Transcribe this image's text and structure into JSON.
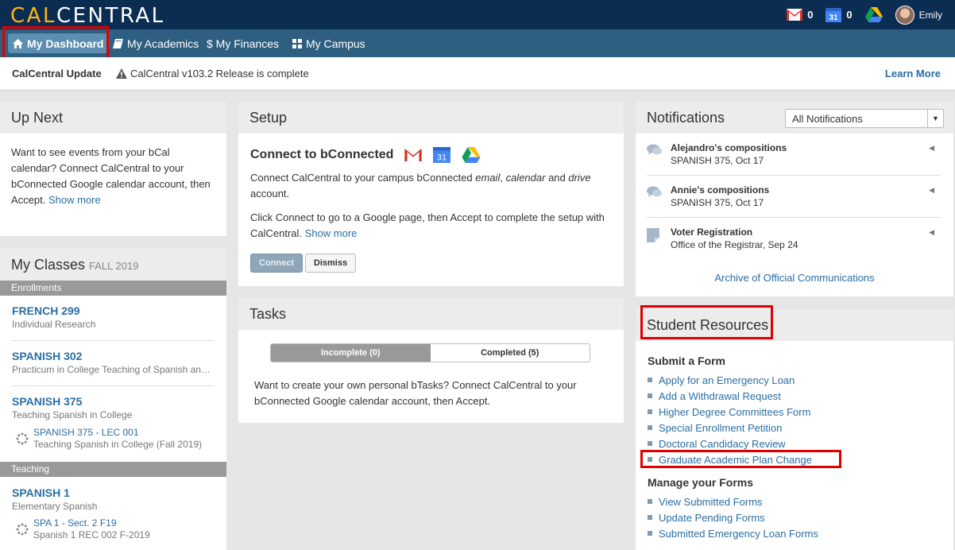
{
  "header": {
    "logo_a": "CAL",
    "logo_b": "CENTRAL",
    "mail_count": "0",
    "calendar_day": "31",
    "calendar_count": "0",
    "user_name": "Emily"
  },
  "nav": [
    {
      "label": "My Dashboard",
      "icon": "home-icon"
    },
    {
      "label": "My Academics",
      "icon": "book-icon"
    },
    {
      "label": "$ My Finances",
      "icon": "dollar-icon"
    },
    {
      "label": "My Campus",
      "icon": "grid-icon"
    }
  ],
  "update": {
    "label": "CalCentral Update",
    "message": "CalCentral v103.2 Release is complete",
    "learn_more": "Learn More"
  },
  "upnext": {
    "title": "Up Next",
    "text": "Want to see events from your bCal calendar? Connect CalCentral to your bConnected Google calendar account, then Accept.",
    "show_more": "Show more"
  },
  "classes": {
    "title": "My Classes",
    "term": "FALL 2019",
    "enrollments_label": "Enrollments",
    "teaching_label": "Teaching",
    "enrollments": [
      {
        "title": "FRENCH 299",
        "desc": "Individual Research"
      },
      {
        "title": "SPANISH 302",
        "desc": "Practicum in College Teaching of Spanish and Portuguese"
      },
      {
        "title": "SPANISH 375",
        "desc": "Teaching Spanish in College",
        "sub_title": "SPANISH 375 - LEC 001",
        "sub_desc": "Teaching Spanish in College (Fall 2019)"
      }
    ],
    "teaching": [
      {
        "title": "SPANISH 1",
        "desc": "Elementary Spanish",
        "sub_title": "SPA 1 - Sect. 2 F19",
        "sub_desc": "Spanish 1 REC 002 F-2019"
      }
    ]
  },
  "setup": {
    "title": "Setup",
    "connect_title": "Connect to bConnected",
    "p1a": "Connect CalCentral to your campus bConnected ",
    "p1_email": "email",
    "p1_sep1": ", ",
    "p1_calendar": "calendar",
    "p1_and": " and ",
    "p1_drive": "drive",
    "p1b": " account.",
    "p2": "Click Connect to go to a Google page, then Accept to complete the setup with CalCentral.",
    "show_more": "Show more",
    "connect_btn": "Connect",
    "dismiss_btn": "Dismiss"
  },
  "tasks": {
    "title": "Tasks",
    "tab_incomplete": "Incomplete (0)",
    "tab_completed": "Completed (5)",
    "text": "Want to create your own personal bTasks? Connect CalCentral to your bConnected Google calendar account, then Accept."
  },
  "notifications": {
    "title": "Notifications",
    "filter": "All Notifications",
    "items": [
      {
        "title": "Alejandro's compositions",
        "desc": "SPANISH 375, Oct 17",
        "icon": "chat-icon"
      },
      {
        "title": "Annie's compositions",
        "desc": "SPANISH 375, Oct 17",
        "icon": "chat-icon"
      },
      {
        "title": "Voter Registration",
        "desc": "Office of the Registrar, Sep 24",
        "icon": "note-icon"
      }
    ],
    "archive": "Archive of Official Communications"
  },
  "resources": {
    "title": "Student Resources",
    "submit_title": "Submit a Form",
    "submit": [
      "Apply for an Emergency Loan",
      "Add a Withdrawal Request",
      "Higher Degree Committees Form",
      "Special Enrollment Petition",
      "Doctoral Candidacy Review",
      "Graduate Academic Plan Change"
    ],
    "manage_title": "Manage your Forms",
    "manage": [
      "View Submitted Forms",
      "Update Pending Forms",
      "Submitted Emergency Loan Forms"
    ]
  },
  "colors": {
    "header": "#0b2d52",
    "nav": "#2e5f80",
    "link": "#2b6ea3",
    "highlight": "#e00000",
    "logo_gold": "#fdb515"
  }
}
